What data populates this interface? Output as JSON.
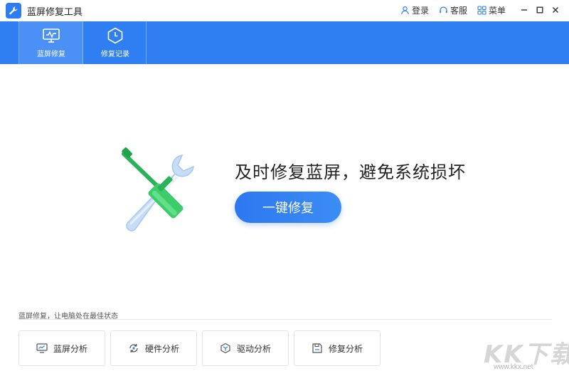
{
  "app": {
    "title": "蓝屏修复工具"
  },
  "titlebar": {
    "login": "登录",
    "service": "客服",
    "menu": "菜单"
  },
  "nav": {
    "tabs": [
      {
        "label": "蓝屏修复",
        "icon": "monitor-icon",
        "active": true
      },
      {
        "label": "修复记录",
        "icon": "clock-icon",
        "active": false
      }
    ]
  },
  "hero": {
    "headline": "及时修复蓝屏，避免系统损坏",
    "button_label": "一键修复",
    "icon": "tools-icon"
  },
  "footer": {
    "caption": "蓝屏修复，让电脑处在最佳状态",
    "items": [
      {
        "label": "蓝屏分析",
        "icon": "monitor-chart-icon"
      },
      {
        "label": "硬件分析",
        "icon": "refresh-cycle-icon"
      },
      {
        "label": "驱动分析",
        "icon": "cube-icon"
      },
      {
        "label": "修复分析",
        "icon": "save-icon"
      }
    ]
  },
  "watermark": {
    "brand": "KK下载",
    "url": "www.kkx.net"
  },
  "colors": {
    "primary": "#2f7ff2",
    "active_tab": "#4a90f5",
    "button": "#2d78ef"
  }
}
